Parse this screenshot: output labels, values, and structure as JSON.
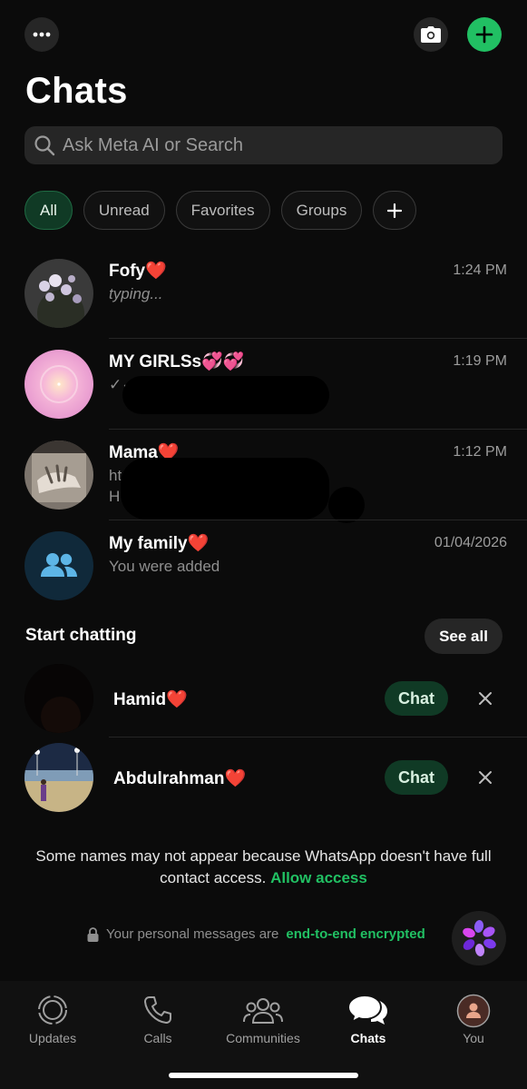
{
  "header": {
    "title": "Chats",
    "more_icon": "more-horizontal-icon",
    "camera_icon": "camera-icon",
    "new_chat_icon": "plus-icon",
    "accent_color": "#21c063"
  },
  "search": {
    "placeholder": "Ask Meta AI or Search",
    "value": ""
  },
  "filters": [
    {
      "label": "All",
      "active": true
    },
    {
      "label": "Unread",
      "active": false
    },
    {
      "label": "Favorites",
      "active": false
    },
    {
      "label": "Groups",
      "active": false
    },
    {
      "label": "+",
      "active": false
    }
  ],
  "chats": [
    {
      "name": "Fofy",
      "emoji": "❤️",
      "time": "1:24 PM",
      "preview": "typing...",
      "preview_style": "italic"
    },
    {
      "name": "MY GIRLSs",
      "emoji": "💞💞",
      "time": "1:19 PM",
      "preview": "✓✓",
      "preview_hidden": true
    },
    {
      "name": "Mama",
      "emoji": "❤️",
      "time": "1:12 PM",
      "preview_line1": "ht",
      "preview_line2": "H",
      "preview_hidden": true
    },
    {
      "name": "My family",
      "emoji": "❤️",
      "time": "01/04/2026",
      "preview": "You were added"
    }
  ],
  "start_chatting": {
    "title": "Start chatting",
    "see_all_label": "See all",
    "contacts": [
      {
        "name": "Hamid",
        "emoji": "❤️",
        "button_label": "Chat"
      },
      {
        "name": "Abdulrahman",
        "emoji": "❤️",
        "button_label": "Chat"
      }
    ]
  },
  "notice": {
    "text": "Some names may not appear because WhatsApp doesn't have full contact access.",
    "link": "Allow access"
  },
  "encryption": {
    "prefix": "Your personal messages are",
    "link": "end-to-end encrypted"
  },
  "tabs": [
    {
      "label": "Updates",
      "icon": "updates-icon",
      "active": false
    },
    {
      "label": "Calls",
      "icon": "phone-icon",
      "active": false
    },
    {
      "label": "Communities",
      "icon": "communities-icon",
      "active": false
    },
    {
      "label": "Chats",
      "icon": "chats-icon",
      "active": true
    },
    {
      "label": "You",
      "icon": "profile-avatar-icon",
      "active": false
    }
  ]
}
